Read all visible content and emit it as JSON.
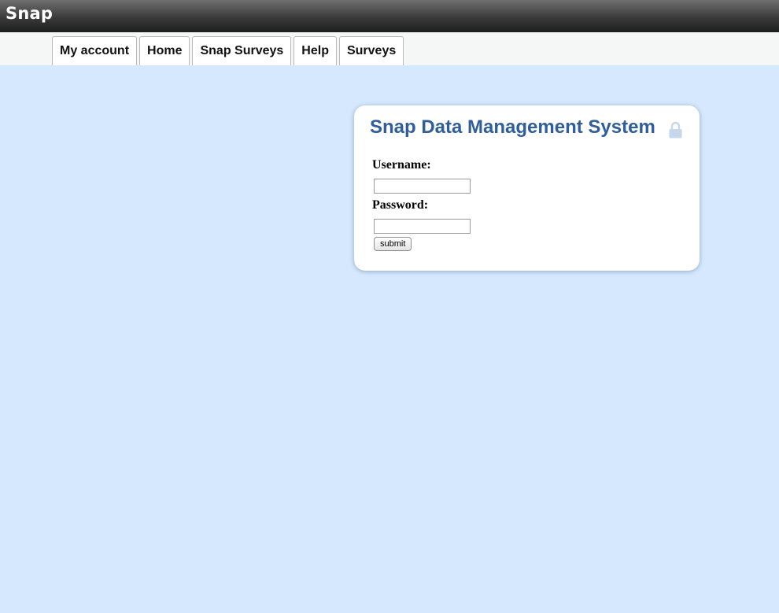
{
  "header": {
    "brand": "Snap"
  },
  "nav": {
    "tabs": [
      {
        "label": "My account"
      },
      {
        "label": "Home"
      },
      {
        "label": "Snap Surveys"
      },
      {
        "label": "Help"
      },
      {
        "label": "Surveys"
      }
    ]
  },
  "login": {
    "title": "Snap Data Management System",
    "lock_icon": "lock-icon",
    "username_label": "Username:",
    "username_value": "",
    "password_label": "Password:",
    "password_value": "",
    "submit_label": "submit"
  },
  "colors": {
    "page_background": "#d5e8fd",
    "title_blue": "#2f5d9e",
    "topbar_dark": "#1e1e1e"
  }
}
